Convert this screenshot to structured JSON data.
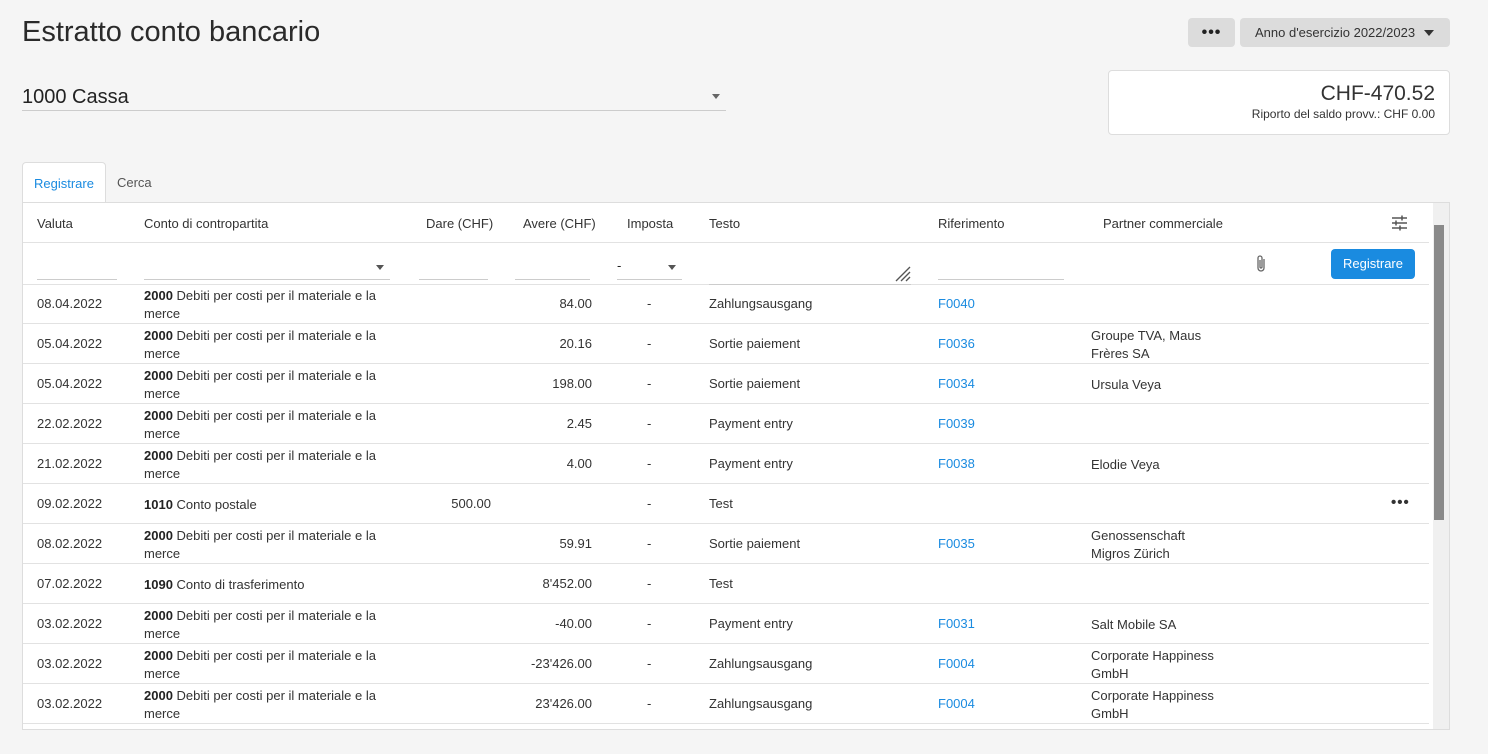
{
  "page": {
    "title": "Estratto conto bancario",
    "more_label": "•••",
    "fiscal_year": "Anno d'esercizio 2022/2023"
  },
  "account": {
    "selected": "1000 Cassa"
  },
  "balance": {
    "amount": "CHF-470.52",
    "carry": "Riporto del saldo provv.: CHF 0.00"
  },
  "tabs": [
    {
      "label": "Registrare",
      "active": true
    },
    {
      "label": "Cerca",
      "active": false
    }
  ],
  "table": {
    "headers": {
      "valuta": "Valuta",
      "conto": "Conto di contropartita",
      "dare": "Dare (CHF)",
      "avere": "Avere (CHF)",
      "imposta": "Imposta",
      "testo": "Testo",
      "riferimento": "Riferimento",
      "partner": "Partner commerciale"
    },
    "filter": {
      "tax_value": "-",
      "register_label": "Registrare"
    },
    "rows": [
      {
        "date": "08.04.2022",
        "acc_num": "2000",
        "acc_name": "Debiti per costi per il materiale e la merce",
        "dare": "",
        "avere": "84.00",
        "tax": "-",
        "text": "Zahlungsausgang",
        "ref": "F0040",
        "partner": ""
      },
      {
        "date": "05.04.2022",
        "acc_num": "2000",
        "acc_name": "Debiti per costi per il materiale e la merce",
        "dare": "",
        "avere": "20.16",
        "tax": "-",
        "text": "Sortie paiement",
        "ref": "F0036",
        "partner": "Groupe TVA, Maus Frères SA"
      },
      {
        "date": "05.04.2022",
        "acc_num": "2000",
        "acc_name": "Debiti per costi per il materiale e la merce",
        "dare": "",
        "avere": "198.00",
        "tax": "-",
        "text": "Sortie paiement",
        "ref": "F0034",
        "partner": "Ursula Veya"
      },
      {
        "date": "22.02.2022",
        "acc_num": "2000",
        "acc_name": "Debiti per costi per il materiale e la merce",
        "dare": "",
        "avere": "2.45",
        "tax": "-",
        "text": "Payment entry",
        "ref": "F0039",
        "partner": ""
      },
      {
        "date": "21.02.2022",
        "acc_num": "2000",
        "acc_name": "Debiti per costi per il materiale e la merce",
        "dare": "",
        "avere": "4.00",
        "tax": "-",
        "text": "Payment entry",
        "ref": "F0038",
        "partner": "Elodie Veya"
      },
      {
        "date": "09.02.2022",
        "acc_num": "1010",
        "acc_name": "Conto postale",
        "dare": "500.00",
        "avere": "",
        "tax": "-",
        "text": "Test",
        "ref": "",
        "partner": "",
        "more": "•••"
      },
      {
        "date": "08.02.2022",
        "acc_num": "2000",
        "acc_name": "Debiti per costi per il materiale e la merce",
        "dare": "",
        "avere": "59.91",
        "tax": "-",
        "text": "Sortie paiement",
        "ref": "F0035",
        "partner": "Genossenschaft Migros Zürich"
      },
      {
        "date": "07.02.2022",
        "acc_num": "1090",
        "acc_name": "Conto di trasferimento",
        "dare": "",
        "avere": "8'452.00",
        "tax": "-",
        "text": "Test",
        "ref": "",
        "partner": ""
      },
      {
        "date": "03.02.2022",
        "acc_num": "2000",
        "acc_name": "Debiti per costi per il materiale e la merce",
        "dare": "",
        "avere": "-40.00",
        "tax": "-",
        "text": "Payment entry",
        "ref": "F0031",
        "partner": "Salt Mobile SA"
      },
      {
        "date": "03.02.2022",
        "acc_num": "2000",
        "acc_name": "Debiti per costi per il materiale e la merce",
        "dare": "",
        "avere": "-23'426.00",
        "tax": "-",
        "text": "Zahlungsausgang",
        "ref": "F0004",
        "partner": "Corporate Happiness GmbH"
      },
      {
        "date": "03.02.2022",
        "acc_num": "2000",
        "acc_name": "Debiti per costi per il materiale e la merce",
        "dare": "",
        "avere": "23'426.00",
        "tax": "-",
        "text": "Zahlungsausgang",
        "ref": "F0004",
        "partner": "Corporate Happiness GmbH"
      }
    ]
  },
  "colors": {
    "accent": "#1a8be0"
  }
}
